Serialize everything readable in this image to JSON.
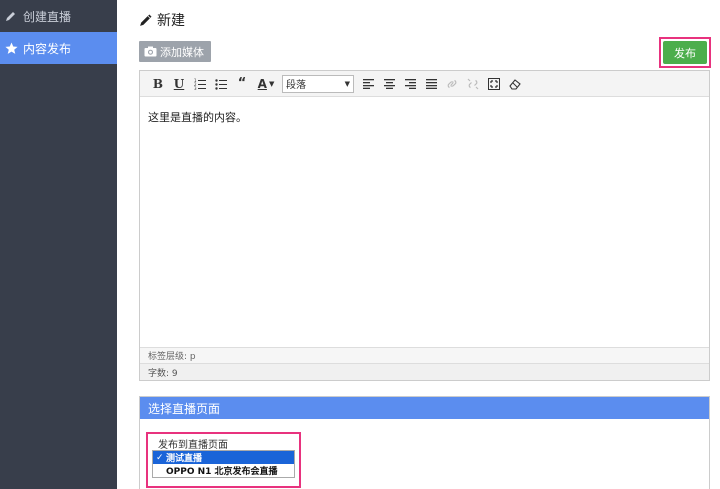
{
  "sidebar": {
    "items": [
      {
        "label": "创建直播",
        "icon": "pencil-icon",
        "active": false
      },
      {
        "label": "内容发布",
        "icon": "star-icon",
        "active": true
      }
    ]
  },
  "header": {
    "title": "新建",
    "icon": "pencil-icon"
  },
  "toolbar": {
    "add_media_label": "添加媒体",
    "publish_label": "发布",
    "bold": "B",
    "underline": "U",
    "quote": "“",
    "text_color": "A",
    "format_value": "段落"
  },
  "editor": {
    "content": "这里是直播的内容。",
    "path_label": "标签层级: p",
    "word_count_label": "字数: 9"
  },
  "live_panel": {
    "title": "选择直播页面",
    "select_label": "发布到直播页面",
    "options": [
      {
        "label": "测试直播",
        "selected": true
      },
      {
        "label": "OPPO N1 北京发布会直播",
        "selected": false
      }
    ]
  },
  "colors": {
    "sidebar_bg": "#383e4b",
    "accent_blue": "#5b8def",
    "publish_green": "#4cae4c",
    "highlight_pink": "#e8327e"
  }
}
